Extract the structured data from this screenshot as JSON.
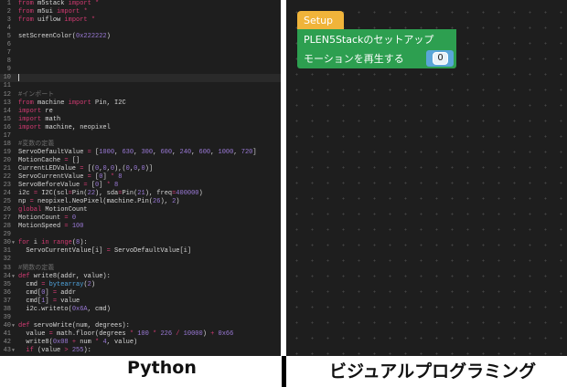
{
  "editor": {
    "active_line": 10,
    "fold_lines": [
      30,
      34,
      40,
      43
    ],
    "lines": [
      [
        [
          "k",
          "from"
        ],
        [
          "t",
          " m5stack "
        ],
        [
          "k",
          "import"
        ],
        [
          "k",
          " *"
        ]
      ],
      [
        [
          "k",
          "from"
        ],
        [
          "t",
          " m5ui "
        ],
        [
          "k",
          "import"
        ],
        [
          "k",
          " *"
        ]
      ],
      [
        [
          "k",
          "from"
        ],
        [
          "t",
          " uiflow "
        ],
        [
          "k",
          "import"
        ],
        [
          "k",
          " *"
        ]
      ],
      [],
      [
        [
          "t",
          "setScreenColor("
        ],
        [
          "n",
          "0x222222"
        ],
        [
          "t",
          ")"
        ]
      ],
      [],
      [],
      [],
      [],
      [],
      [],
      [
        [
          "c",
          "#インポート"
        ]
      ],
      [
        [
          "k",
          "from"
        ],
        [
          "t",
          " machine "
        ],
        [
          "k",
          "import"
        ],
        [
          "t",
          " Pin, I2C"
        ]
      ],
      [
        [
          "k",
          "import"
        ],
        [
          "t",
          " re"
        ]
      ],
      [
        [
          "k",
          "import"
        ],
        [
          "t",
          " math"
        ]
      ],
      [
        [
          "k",
          "import"
        ],
        [
          "t",
          " machine, neopixel"
        ]
      ],
      [],
      [
        [
          "c",
          "#変数の定義"
        ]
      ],
      [
        [
          "t",
          "ServoDefaultValue "
        ],
        [
          "k",
          "="
        ],
        [
          "t",
          " ["
        ],
        [
          "n",
          "1000"
        ],
        [
          "t",
          ", "
        ],
        [
          "n",
          "630"
        ],
        [
          "t",
          ", "
        ],
        [
          "n",
          "300"
        ],
        [
          "t",
          ", "
        ],
        [
          "n",
          "600"
        ],
        [
          "t",
          ", "
        ],
        [
          "n",
          "240"
        ],
        [
          "t",
          ", "
        ],
        [
          "n",
          "600"
        ],
        [
          "t",
          ", "
        ],
        [
          "n",
          "1000"
        ],
        [
          "t",
          ", "
        ],
        [
          "n",
          "720"
        ],
        [
          "t",
          "]"
        ]
      ],
      [
        [
          "t",
          "MotionCache "
        ],
        [
          "k",
          "="
        ],
        [
          "t",
          " []"
        ]
      ],
      [
        [
          "t",
          "CurrentLEDValue "
        ],
        [
          "k",
          "="
        ],
        [
          "t",
          " [("
        ],
        [
          "n",
          "0"
        ],
        [
          "t",
          ","
        ],
        [
          "n",
          "0"
        ],
        [
          "t",
          ","
        ],
        [
          "n",
          "0"
        ],
        [
          "t",
          "),("
        ],
        [
          "n",
          "0"
        ],
        [
          "t",
          ","
        ],
        [
          "n",
          "0"
        ],
        [
          "t",
          ","
        ],
        [
          "n",
          "0"
        ],
        [
          "t",
          ")]"
        ]
      ],
      [
        [
          "t",
          "ServoCurrentValue "
        ],
        [
          "k",
          "="
        ],
        [
          "t",
          " ["
        ],
        [
          "n",
          "0"
        ],
        [
          "t",
          "] "
        ],
        [
          "k",
          "*"
        ],
        [
          "t",
          " "
        ],
        [
          "n",
          "8"
        ]
      ],
      [
        [
          "t",
          "ServoBeforeValue "
        ],
        [
          "k",
          "="
        ],
        [
          "t",
          " ["
        ],
        [
          "n",
          "0"
        ],
        [
          "t",
          "] "
        ],
        [
          "k",
          "*"
        ],
        [
          "t",
          " "
        ],
        [
          "n",
          "8"
        ]
      ],
      [
        [
          "t",
          "i2c "
        ],
        [
          "k",
          "="
        ],
        [
          "t",
          " I2C(scl"
        ],
        [
          "k",
          "="
        ],
        [
          "t",
          "Pin("
        ],
        [
          "n",
          "22"
        ],
        [
          "t",
          "), sda"
        ],
        [
          "k",
          "="
        ],
        [
          "t",
          "Pin("
        ],
        [
          "n",
          "21"
        ],
        [
          "t",
          "), freq"
        ],
        [
          "k",
          "="
        ],
        [
          "n",
          "400000"
        ],
        [
          "t",
          ")"
        ]
      ],
      [
        [
          "t",
          "np "
        ],
        [
          "k",
          "="
        ],
        [
          "t",
          " neopixel.NeoPixel(machine.Pin("
        ],
        [
          "n",
          "26"
        ],
        [
          "t",
          "), "
        ],
        [
          "n",
          "2"
        ],
        [
          "t",
          ")"
        ]
      ],
      [
        [
          "k",
          "global"
        ],
        [
          "t",
          " MotionCount"
        ]
      ],
      [
        [
          "t",
          "MotionCount "
        ],
        [
          "k",
          "="
        ],
        [
          "t",
          " "
        ],
        [
          "n",
          "0"
        ]
      ],
      [
        [
          "t",
          "MotionSpeed "
        ],
        [
          "k",
          "="
        ],
        [
          "t",
          " "
        ],
        [
          "n",
          "100"
        ]
      ],
      [],
      [
        [
          "k",
          "for"
        ],
        [
          "t",
          " i "
        ],
        [
          "k",
          "in"
        ],
        [
          "t",
          " "
        ],
        [
          "k",
          "range"
        ],
        [
          "t",
          "("
        ],
        [
          "n",
          "8"
        ],
        [
          "t",
          "):"
        ]
      ],
      [
        [
          "t",
          "  ServoCurrentValue[i] "
        ],
        [
          "k",
          "="
        ],
        [
          "t",
          " ServoDefaultValue[i]"
        ]
      ],
      [],
      [
        [
          "c",
          "#関数の定義"
        ]
      ],
      [
        [
          "k",
          "def"
        ],
        [
          "t",
          " write8(addr, value):"
        ]
      ],
      [
        [
          "t",
          "  cmd "
        ],
        [
          "k",
          "="
        ],
        [
          "t",
          " "
        ],
        [
          "b",
          "bytearray"
        ],
        [
          "t",
          "("
        ],
        [
          "n",
          "2"
        ],
        [
          "t",
          ")"
        ]
      ],
      [
        [
          "t",
          "  cmd["
        ],
        [
          "n",
          "0"
        ],
        [
          "t",
          "] "
        ],
        [
          "k",
          "="
        ],
        [
          "t",
          " addr"
        ]
      ],
      [
        [
          "t",
          "  cmd["
        ],
        [
          "n",
          "1"
        ],
        [
          "t",
          "] "
        ],
        [
          "k",
          "="
        ],
        [
          "t",
          " value"
        ]
      ],
      [
        [
          "t",
          "  i2c.writeto("
        ],
        [
          "n",
          "0x6A"
        ],
        [
          "t",
          ", cmd)"
        ]
      ],
      [],
      [
        [
          "k",
          "def"
        ],
        [
          "t",
          " servoWrite(num, degrees):"
        ]
      ],
      [
        [
          "t",
          "  value "
        ],
        [
          "k",
          "="
        ],
        [
          "t",
          " math.floor(degrees "
        ],
        [
          "k",
          "*"
        ],
        [
          "t",
          " "
        ],
        [
          "n",
          "100"
        ],
        [
          "t",
          " "
        ],
        [
          "k",
          "*"
        ],
        [
          "t",
          " "
        ],
        [
          "n",
          "226"
        ],
        [
          "t",
          " "
        ],
        [
          "k",
          "/"
        ],
        [
          "t",
          " "
        ],
        [
          "n",
          "10000"
        ],
        [
          "t",
          ") "
        ],
        [
          "k",
          "+"
        ],
        [
          "t",
          " "
        ],
        [
          "n",
          "0x66"
        ]
      ],
      [
        [
          "t",
          "  write8("
        ],
        [
          "n",
          "0x08"
        ],
        [
          "t",
          " "
        ],
        [
          "k",
          "+"
        ],
        [
          "t",
          " num "
        ],
        [
          "k",
          "*"
        ],
        [
          "t",
          " "
        ],
        [
          "n",
          "4"
        ],
        [
          "t",
          ", value)"
        ]
      ],
      [
        [
          "t",
          "  "
        ],
        [
          "k",
          "if"
        ],
        [
          "t",
          " (value "
        ],
        [
          "k",
          ">"
        ],
        [
          "t",
          " "
        ],
        [
          "n",
          "255"
        ],
        [
          "t",
          "):"
        ]
      ]
    ]
  },
  "blocks": {
    "setup": "Setup",
    "plen_setup": "PLEN5Stackのセットアップ",
    "play_motion": "モーションを再生する",
    "motion_number": "0"
  },
  "labels": {
    "left": "Python",
    "right": "ビジュアルプログラミング"
  }
}
